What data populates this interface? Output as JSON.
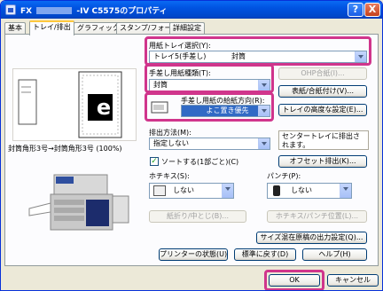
{
  "window": {
    "title_prefix": "FX",
    "title_suffix": "-IV C5575のプロパティ",
    "help_label": "?",
    "close_label": "X"
  },
  "tabs": [
    {
      "label": "基本"
    },
    {
      "label": "トレイ/排出"
    },
    {
      "label": "グラフィックス"
    },
    {
      "label": "スタンプ/フォーム"
    },
    {
      "label": "詳細設定"
    }
  ],
  "preview": {
    "caption": "封筒角形3号→封筒角形3号 (100%)",
    "page_letter": "e"
  },
  "paper_tray": {
    "label": "用紙トレイ選択(Y):",
    "value_tray": "トレイ5(手差し)",
    "value_paper": "封筒"
  },
  "manual_paper_type": {
    "label": "手差し用紙種類(T):",
    "value": "封筒"
  },
  "feed_direction": {
    "label": "手差し用紙の給紙方向(R):",
    "value": "よこ置き優先"
  },
  "buttons": {
    "ohp": "OHP合紙(I)...",
    "cover": "表紙/合紙付け(V)...",
    "tray_advanced": "トレイの高度な設定(E)...",
    "offset": "オフセット排出(K)...",
    "fold": "紙折り/中とじ(B)...",
    "stapler_position": "ホチキス/パンチ位置(L)...",
    "mixed_size": "サイズ混在原稿の出力設定(Q)...",
    "printer_status": "プリンターの状態(U)",
    "restore_defaults": "標準に戻す(D)",
    "help": "ヘルプ(H)",
    "ok": "OK",
    "cancel": "キャンセル"
  },
  "output": {
    "method_label": "排出方法(M):",
    "method_value": "指定しない",
    "center_tray_note": "センタートレイに排出されます。",
    "collate_label": "ソートする(1部ごと)(C)",
    "collate_checked": "✓"
  },
  "stapler": {
    "label": "ホチキス(S):",
    "value": "しない"
  },
  "punch": {
    "label": "パンチ(P):",
    "value": "しない"
  },
  "colors": {
    "highlight": "#d0358c",
    "selection": "#316ac5"
  }
}
